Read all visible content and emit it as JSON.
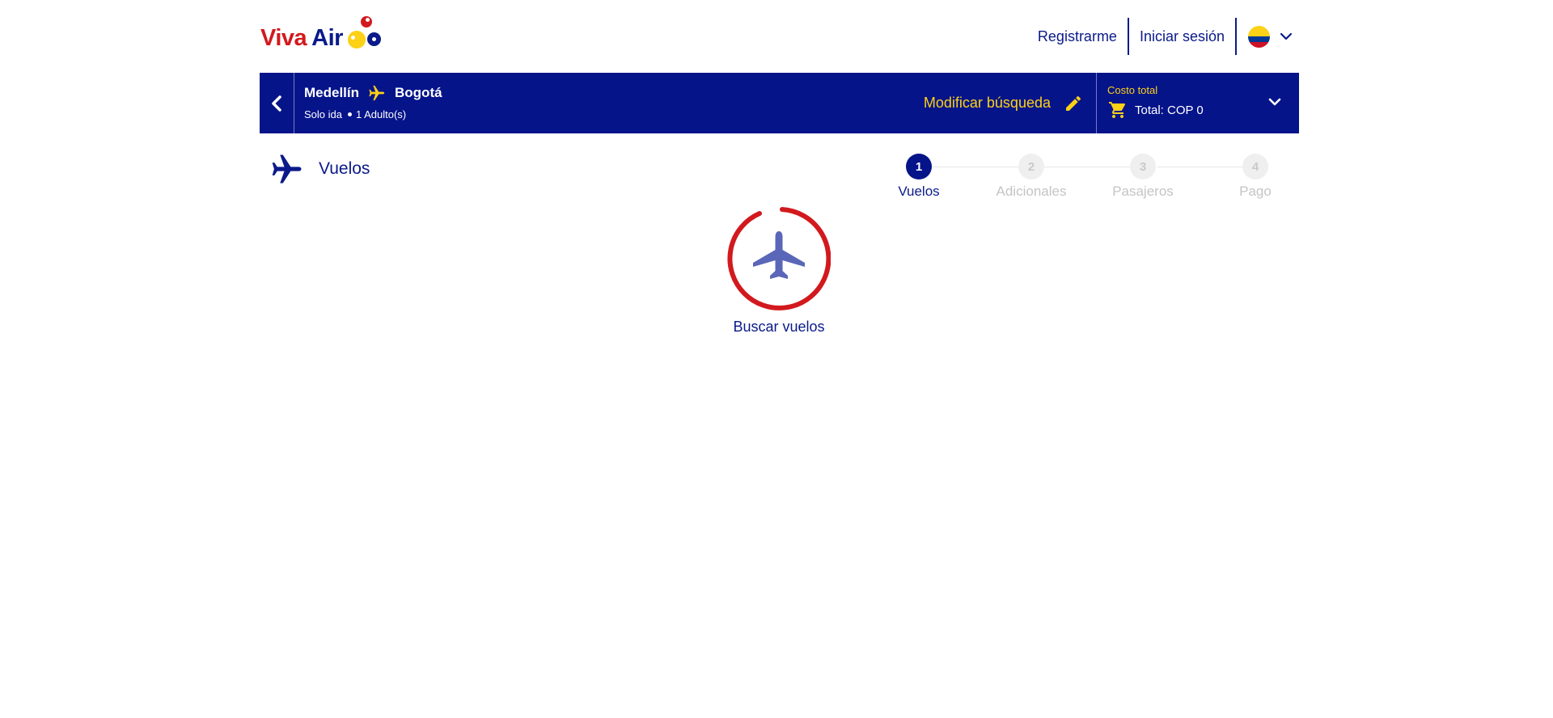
{
  "brand": {
    "word1": "Viva",
    "word2": "Air"
  },
  "nav": {
    "register": "Registrarme",
    "login": "Iniciar sesión",
    "language_flag": "colombia-flag"
  },
  "summary": {
    "origin": "Medellín",
    "destination": "Bogotá",
    "trip_type": "Solo ida",
    "passengers": "1 Adulto(s)",
    "modify_label": "Modificar búsqueda",
    "cost_label": "Costo total",
    "total_label": "Total: COP 0"
  },
  "section": {
    "title": "Vuelos"
  },
  "steps": [
    {
      "number": "1",
      "label": "Vuelos",
      "state": "active"
    },
    {
      "number": "2",
      "label": "Adicionales",
      "state": "inactive"
    },
    {
      "number": "3",
      "label": "Pasajeros",
      "state": "inactive"
    },
    {
      "number": "4",
      "label": "Pago",
      "state": "inactive"
    }
  ],
  "loader": {
    "label": "Buscar vuelos"
  },
  "colors": {
    "brand_blue": "#06148a",
    "brand_red": "#d2191e",
    "brand_yellow": "#fcd116",
    "loader_plane": "#5a66b8"
  }
}
